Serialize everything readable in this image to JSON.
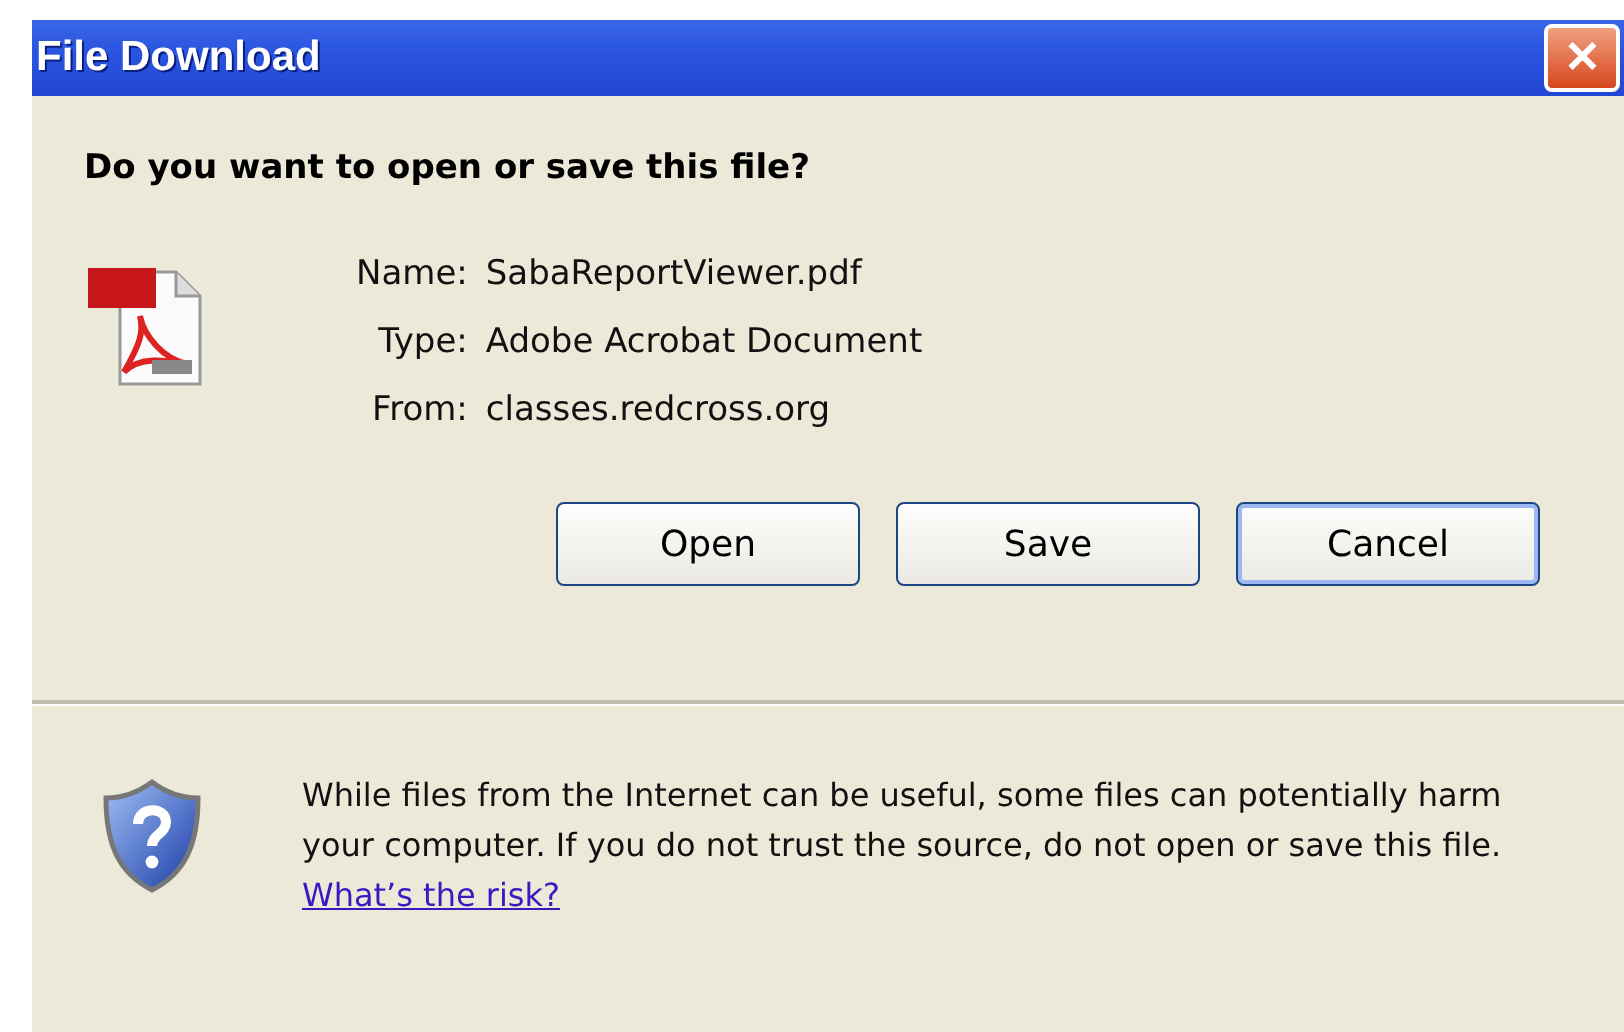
{
  "window": {
    "title": "File Download",
    "close": "✕"
  },
  "question": "Do you want to open or save this file?",
  "details": [
    {
      "label": "Name:",
      "value": "SabaReportViewer.pdf"
    },
    {
      "label": "Type:",
      "value": "Adobe Acrobat Document"
    },
    {
      "label": "From:",
      "value": "classes.redcross.org"
    }
  ],
  "buttons": [
    {
      "label": "Open",
      "default": false
    },
    {
      "label": "Save",
      "default": false
    },
    {
      "label": "Cancel",
      "default": true
    }
  ],
  "warning": {
    "text": "While files from the Internet can be useful, some files can potentially harm your computer. If you do not trust the source, do not open or save this file.",
    "link": "What’s the risk?"
  }
}
